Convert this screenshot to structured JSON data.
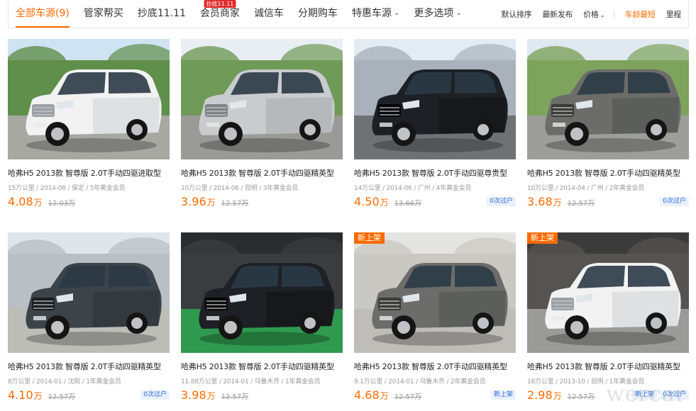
{
  "filter_tabs": [
    {
      "label": "全部车源(9)",
      "active": true
    },
    {
      "label": "管家帮买"
    },
    {
      "label": "抄底11.11"
    },
    {
      "label": "会员商家",
      "badge": "抄底11.11"
    },
    {
      "label": "诚信车"
    },
    {
      "label": "分期购车"
    },
    {
      "label": "特惠车源",
      "dropdown": true
    },
    {
      "label": "更多选项",
      "dropdown": true
    }
  ],
  "sort_options": [
    {
      "label": "默认排序"
    },
    {
      "label": "最新发布"
    },
    {
      "label": "价格",
      "dropdown": true
    },
    {
      "label": "车龄最短",
      "active": true
    },
    {
      "label": "里程"
    }
  ],
  "colors": {
    "accent": "#ff6a00",
    "badge_blue": "#2b6ad6",
    "badge_red": "#e02a2a"
  },
  "cars": [
    {
      "title": "哈弗H5 2013款 智尊版 2.0T手动四驱进取型",
      "meta": "15万公里 / 2014-08 / 保定 / 5年黄金会员",
      "price": "4.08",
      "unit": "万",
      "original": "12.03万",
      "badges": [],
      "new_tag": "",
      "car_color": "white",
      "scene": "park"
    },
    {
      "title": "哈弗H5 2013款 智尊版 2.0T手动四驱精英型",
      "meta": "10万公里 / 2014-06 / 昆明 / 3年黄金会员",
      "price": "3.96",
      "unit": "万",
      "original": "12.57万",
      "badges": [],
      "new_tag": "",
      "car_color": "silver",
      "scene": "lot"
    },
    {
      "title": "哈弗H5 2013款 智尊版 2.0T手动四驱尊贵型",
      "meta": "14万公里 / 2014-06 / 广州 / 4年黄金会员",
      "price": "4.50",
      "unit": "万",
      "original": "13.66万",
      "badges": [
        "0次过户"
      ],
      "new_tag": "",
      "car_color": "black",
      "scene": "city"
    },
    {
      "title": "哈弗H5 2013款 智尊版 2.0T手动四驱精英型",
      "meta": "10万公里 / 2014-04 / 广州 / 2年黄金会员",
      "price": "3.68",
      "unit": "万",
      "original": "12.57万",
      "badges": [
        "0次过户"
      ],
      "new_tag": "",
      "car_color": "gray",
      "scene": "willow"
    },
    {
      "title": "哈弗H5 2013款 智尊版 2.0T手动四驱精英型",
      "meta": "8万公里 / 2014-01 / 沈阳 / 1年黄金会员",
      "price": "4.10",
      "unit": "万",
      "original": "12.57万",
      "badges": [
        "0次过户"
      ],
      "new_tag": "",
      "car_color": "darkgray",
      "scene": "building"
    },
    {
      "title": "哈弗H5 2013款 智尊版 2.0T手动四驱精英型",
      "meta": "11.88万公里 / 2014-01 / 乌鲁木齐 / 1年黄金会员",
      "price": "3.98",
      "unit": "万",
      "original": "12.57万",
      "badges": [],
      "new_tag": "",
      "car_color": "black",
      "scene": "studio"
    },
    {
      "title": "哈弗H5 2013款 智尊版 2.0T手动四驱精英型",
      "meta": "9.1万公里 / 2014-01 / 乌鲁木齐 / 2年黄金会员",
      "price": "4.68",
      "unit": "万",
      "original": "12.57万",
      "badges": [
        "新上架"
      ],
      "new_tag": "新上架",
      "car_color": "gray",
      "scene": "showroom"
    },
    {
      "title": "哈弗H5 2013款 智尊版 2.0T手动四驱精英型",
      "meta": "18万公里 / 2013-10 / 昆明 / 1年黄金会员",
      "price": "2.98",
      "unit": "万",
      "original": "12.57万",
      "badges": [
        "新上架",
        "0次过户"
      ],
      "new_tag": "新上架",
      "car_color": "white",
      "scene": "garage"
    }
  ],
  "watermark": "wercar"
}
